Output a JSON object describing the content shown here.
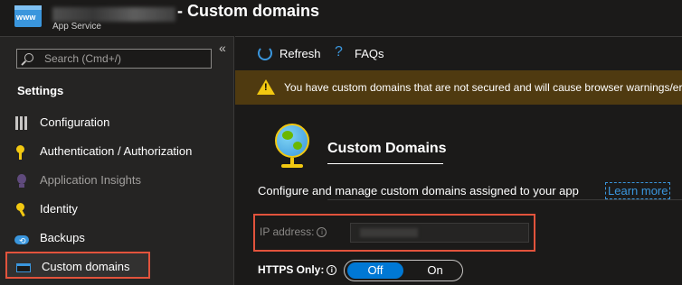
{
  "header": {
    "app_icon_text": "www",
    "title": "- Custom domains",
    "subtitle": "App Service"
  },
  "sidebar": {
    "search_placeholder": "Search (Cmd+/)",
    "collapse_glyph": "«",
    "section_title": "Settings",
    "items": [
      {
        "label": "Configuration",
        "icon": "configuration-icon"
      },
      {
        "label": "Authentication / Authorization",
        "icon": "key-icon"
      },
      {
        "label": "Application Insights",
        "icon": "lightbulb-icon",
        "disabled": true
      },
      {
        "label": "Identity",
        "icon": "identity-key-icon"
      },
      {
        "label": "Backups",
        "icon": "cloud-backup-icon"
      },
      {
        "label": "Custom domains",
        "icon": "custom-domains-icon",
        "active": true
      }
    ]
  },
  "toolbar": {
    "refresh_label": "Refresh",
    "faq_icon": "?",
    "faq_label": "FAQs"
  },
  "warning": {
    "text": "You have custom domains that are not secured and will cause browser warnings/er"
  },
  "main": {
    "heading": "Custom Domains",
    "description": "Configure and manage custom domains assigned to your app",
    "learn_more": "Learn more",
    "ip_label": "IP address:",
    "https_label": "HTTPS Only:",
    "toggle_off": "Off",
    "toggle_on": "On",
    "https_only": "Off"
  },
  "colors": {
    "accent": "#0078d4",
    "link": "#3a96dd",
    "highlight_border": "#e2533c",
    "warning_bg": "#4f3a10",
    "warning_icon": "#f2c811"
  }
}
